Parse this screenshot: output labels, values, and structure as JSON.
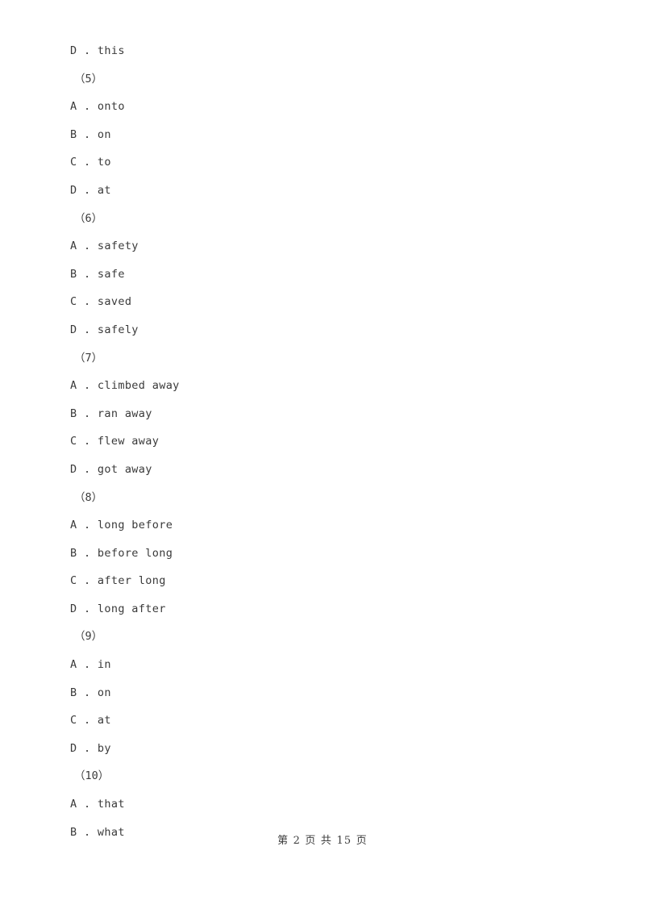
{
  "page": {
    "background_color": "#ffffff",
    "text_color": "#3a3a3a"
  },
  "blocks": [
    {
      "kind": "option",
      "letter": "D",
      "separator": " . ",
      "text": "this"
    },
    {
      "kind": "question_number",
      "label": "（5）"
    },
    {
      "kind": "option",
      "letter": "A",
      "separator": " . ",
      "text": "onto"
    },
    {
      "kind": "option",
      "letter": "B",
      "separator": " . ",
      "text": "on"
    },
    {
      "kind": "option",
      "letter": "C",
      "separator": " . ",
      "text": "to"
    },
    {
      "kind": "option",
      "letter": "D",
      "separator": " . ",
      "text": "at"
    },
    {
      "kind": "question_number",
      "label": "（6）"
    },
    {
      "kind": "option",
      "letter": "A",
      "separator": " . ",
      "text": "safety"
    },
    {
      "kind": "option",
      "letter": "B",
      "separator": " . ",
      "text": "safe"
    },
    {
      "kind": "option",
      "letter": "C",
      "separator": " . ",
      "text": "saved"
    },
    {
      "kind": "option",
      "letter": "D",
      "separator": " . ",
      "text": "safely"
    },
    {
      "kind": "question_number",
      "label": "（7）"
    },
    {
      "kind": "option",
      "letter": "A",
      "separator": " . ",
      "text": "climbed away"
    },
    {
      "kind": "option",
      "letter": "B",
      "separator": " . ",
      "text": "ran away"
    },
    {
      "kind": "option",
      "letter": "C",
      "separator": " . ",
      "text": "flew away"
    },
    {
      "kind": "option",
      "letter": "D",
      "separator": " . ",
      "text": "got away"
    },
    {
      "kind": "question_number",
      "label": "（8）"
    },
    {
      "kind": "option",
      "letter": "A",
      "separator": " . ",
      "text": "long before"
    },
    {
      "kind": "option",
      "letter": "B",
      "separator": " . ",
      "text": "before long"
    },
    {
      "kind": "option",
      "letter": "C",
      "separator": " . ",
      "text": "after long"
    },
    {
      "kind": "option",
      "letter": "D",
      "separator": " . ",
      "text": "long after"
    },
    {
      "kind": "question_number",
      "label": "（9）"
    },
    {
      "kind": "option",
      "letter": "A",
      "separator": " . ",
      "text": "in"
    },
    {
      "kind": "option",
      "letter": "B",
      "separator": " . ",
      "text": "on"
    },
    {
      "kind": "option",
      "letter": "C",
      "separator": " . ",
      "text": "at"
    },
    {
      "kind": "option",
      "letter": "D",
      "separator": " . ",
      "text": "by"
    },
    {
      "kind": "question_number",
      "label": "（10）"
    },
    {
      "kind": "option",
      "letter": "A",
      "separator": " . ",
      "text": "that"
    },
    {
      "kind": "option",
      "letter": "B",
      "separator": " . ",
      "text": "what"
    }
  ],
  "footer": {
    "text": "第 2 页 共 15 页",
    "current_page": "2",
    "total_pages": "15"
  }
}
